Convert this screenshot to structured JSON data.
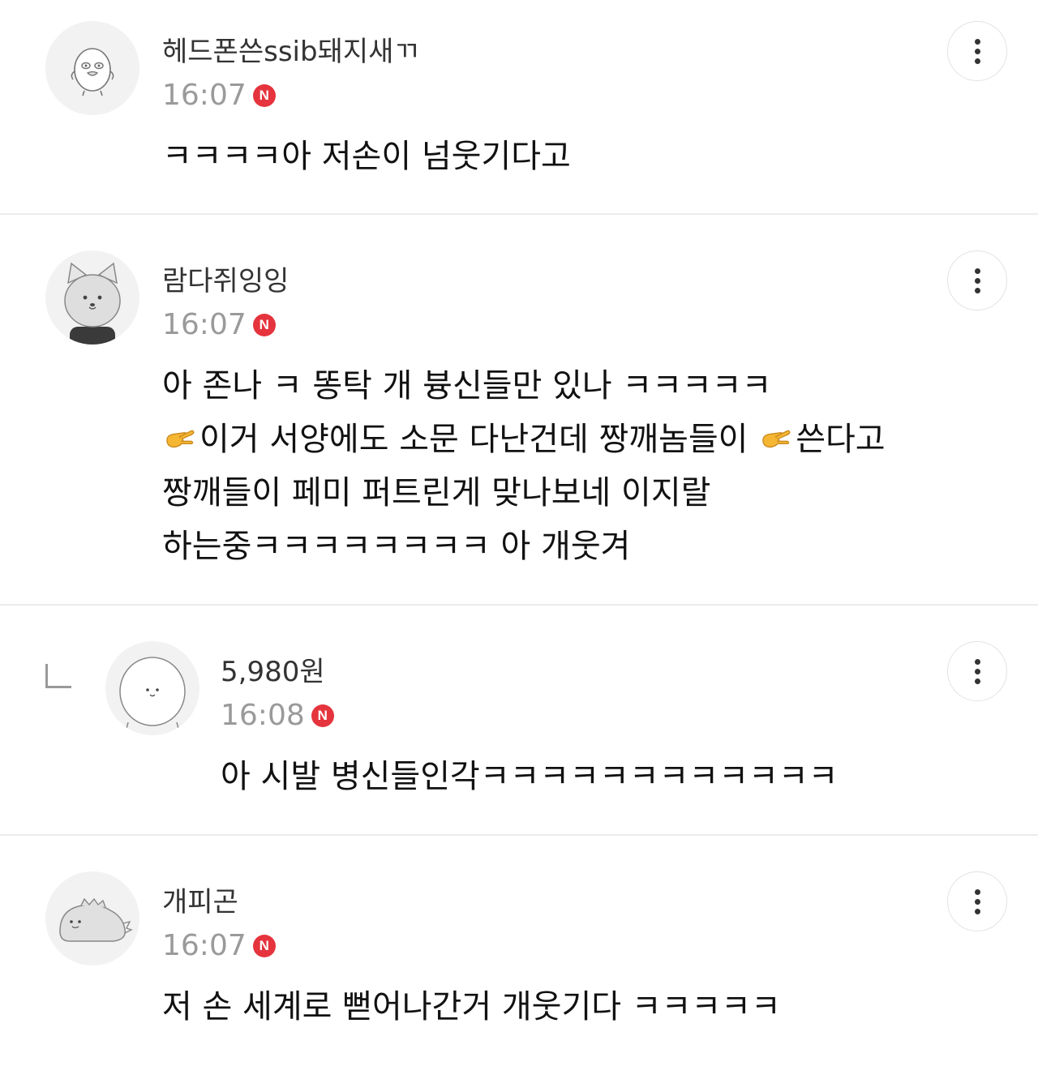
{
  "comments": [
    {
      "nickname": "헤드폰쓴ssib돼지새ㄲ",
      "time": "16:07",
      "badge": "N",
      "lines": [
        "ㅋㅋㅋㅋ아 저손이 넘웃기다고"
      ],
      "avatar_icon": "duck-character-icon"
    },
    {
      "nickname": "람다쥐잉잉",
      "time": "16:07",
      "badge": "N",
      "lines": [
        "아 존나 ㅋ 똥탁 개 븅신들만 있나 ㅋㅋㅋㅋㅋ",
        "이거 서양에도 소문 다난건데 짱깨놈들이 ",
        "쓴다고",
        "짱깨들이 페미 퍼트린게 맞나보네 이지랄",
        "하는중ㅋㅋㅋㅋㅋㅋㅋㅋ 아 개웃겨"
      ],
      "emoji_icon": "pinching-hand-emoji",
      "avatar_icon": "cat-character-icon"
    },
    {
      "nickname": "5,980원",
      "time": "16:08",
      "badge": "N",
      "lines": [
        "아 시발 병신들인각ㅋㅋㅋㅋㅋㅋㅋㅋㅋㅋㅋㅋ"
      ],
      "avatar_icon": "blob-character-icon",
      "is_reply": true
    },
    {
      "nickname": "개피곤",
      "time": "16:07",
      "badge": "N",
      "lines": [
        "저 손 세계로 뻗어나간거 개웃기다 ㅋㅋㅋㅋㅋ"
      ],
      "avatar_icon": "dinosaur-character-icon"
    }
  ],
  "colors": {
    "badge": "#e5343d",
    "time": "#9a9a9a",
    "divider": "#ececec"
  }
}
